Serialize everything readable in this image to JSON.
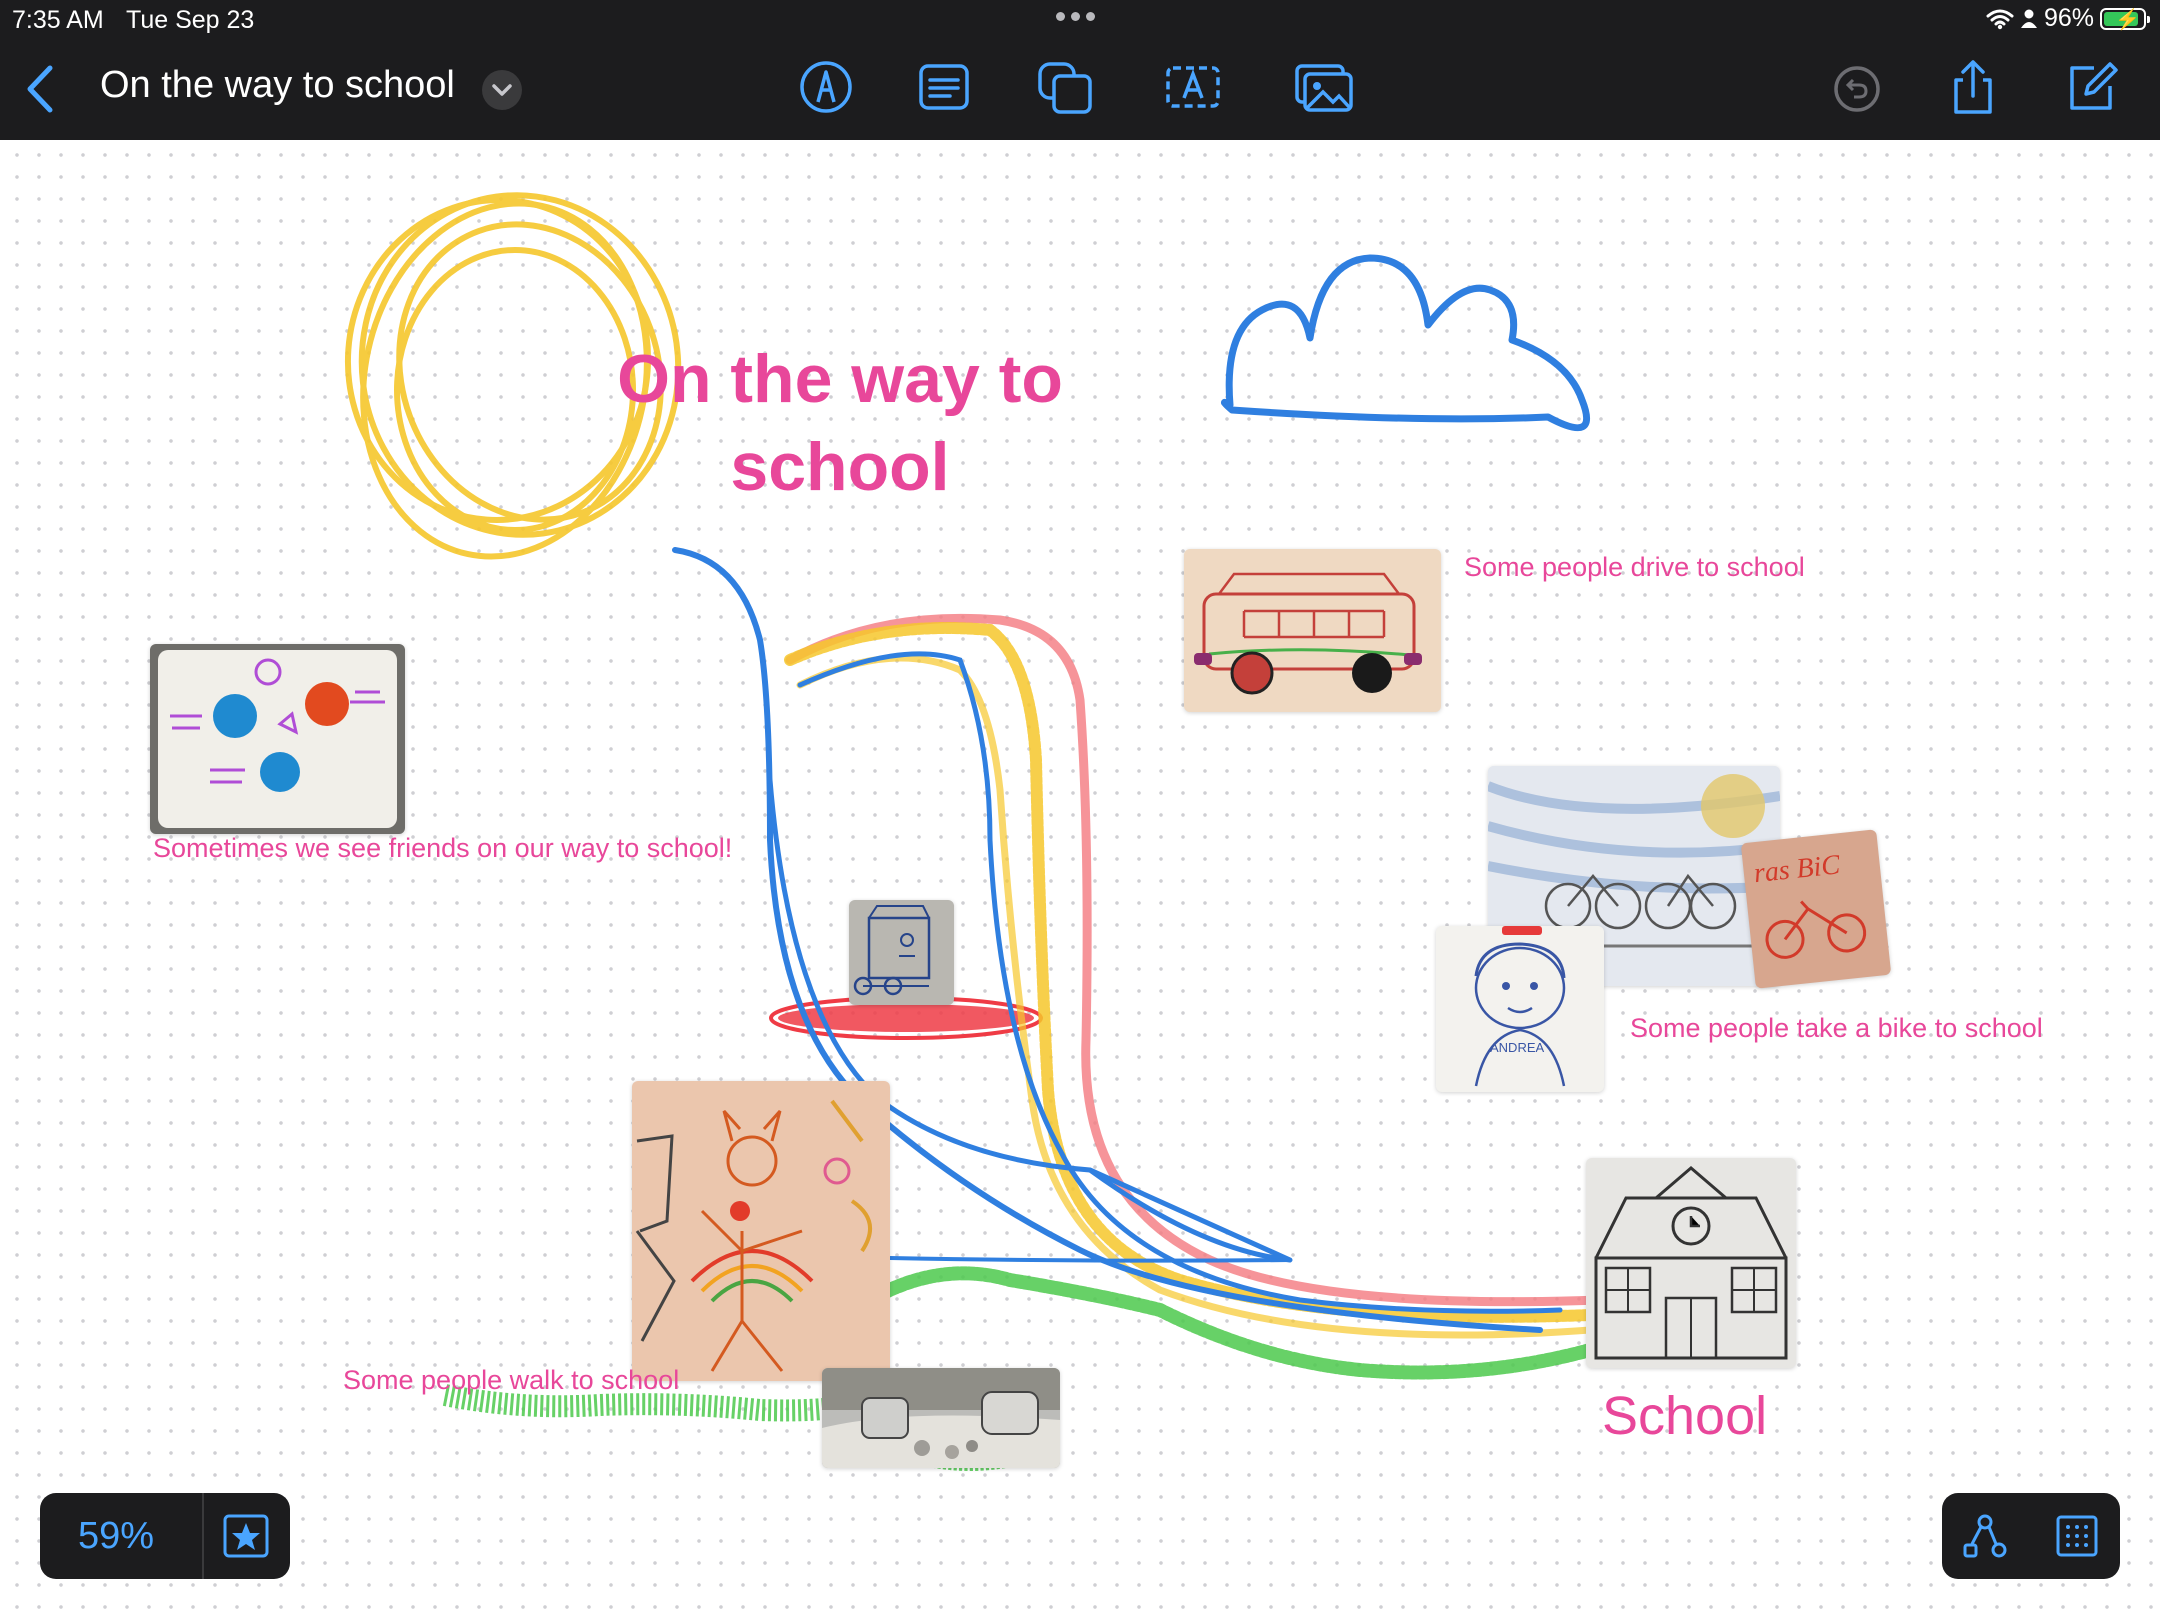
{
  "status_bar": {
    "time": "7:35 AM",
    "date": "Tue Sep 23",
    "battery": "96%",
    "icons": [
      "wifi-icon",
      "person-icon",
      "battery-charging-icon"
    ]
  },
  "nav": {
    "title": "On the way to school",
    "back_icon": "chevron-left-icon",
    "title_menu_icon": "chevron-down-icon",
    "tools": [
      "pen-icon",
      "note-icon",
      "shapes-icon",
      "text-box-icon",
      "media-icon"
    ],
    "actions": [
      "undo-icon",
      "share-icon",
      "compose-icon"
    ]
  },
  "board": {
    "title": "On the way to school",
    "captions": {
      "friends": "Sometimes we see friends on our way to school!",
      "drive": "Some people drive to school",
      "bike": "Some people take a bike to school",
      "walk": "Some people walk to school",
      "school": "School"
    },
    "photo_texts": {
      "bike_note": "ras BiC",
      "portrait_name": "ANDREA"
    }
  },
  "controls": {
    "zoom": "59%",
    "favorite_icon": "star-icon",
    "connector_icon": "connector-icon",
    "grid_icon": "grid-icon"
  },
  "colors": {
    "accent": "#4aa5ff",
    "title_pink": "#e8479a",
    "toolbar_bg": "#1c1c1e",
    "crayon_yellow": "#f6c72c",
    "crayon_blue": "#2f7fe0",
    "crayon_red": "#ef3b45",
    "crayon_green": "#4cc94c"
  }
}
